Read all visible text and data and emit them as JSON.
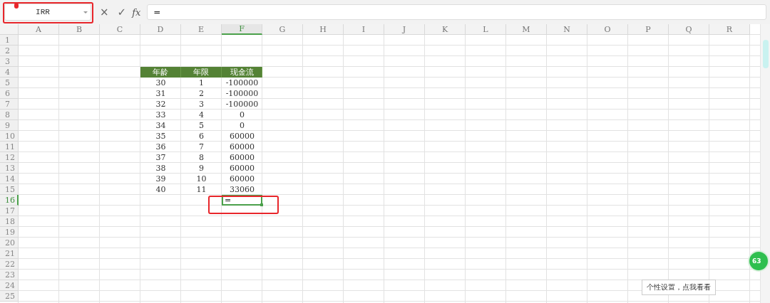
{
  "formula_bar": {
    "name_box": "IRR",
    "cancel_symbol": "×",
    "confirm_symbol": "✓",
    "function_label": "fx",
    "formula": "="
  },
  "columns": [
    {
      "label": "A",
      "selected": false
    },
    {
      "label": "B",
      "selected": false
    },
    {
      "label": "C",
      "selected": false
    },
    {
      "label": "D",
      "selected": false
    },
    {
      "label": "E",
      "selected": false
    },
    {
      "label": "F",
      "selected": true
    },
    {
      "label": "G",
      "selected": false
    },
    {
      "label": "H",
      "selected": false
    },
    {
      "label": "I",
      "selected": false
    },
    {
      "label": "J",
      "selected": false
    },
    {
      "label": "K",
      "selected": false
    },
    {
      "label": "L",
      "selected": false
    },
    {
      "label": "M",
      "selected": false
    },
    {
      "label": "N",
      "selected": false
    },
    {
      "label": "O",
      "selected": false
    },
    {
      "label": "P",
      "selected": false
    },
    {
      "label": "Q",
      "selected": false
    },
    {
      "label": "R",
      "selected": false
    }
  ],
  "rows": [
    {
      "label": "1",
      "selected": false
    },
    {
      "label": "2",
      "selected": false
    },
    {
      "label": "3",
      "selected": false
    },
    {
      "label": "4",
      "selected": false,
      "header": true,
      "cells": {
        "D": "年龄",
        "E": "年限",
        "F": "现金流"
      }
    },
    {
      "label": "5",
      "selected": false,
      "cells": {
        "D": "30",
        "E": "1",
        "F": "-100000"
      }
    },
    {
      "label": "6",
      "selected": false,
      "cells": {
        "D": "31",
        "E": "2",
        "F": "-100000"
      }
    },
    {
      "label": "7",
      "selected": false,
      "cells": {
        "D": "32",
        "E": "3",
        "F": "-100000"
      }
    },
    {
      "label": "8",
      "selected": false,
      "cells": {
        "D": "33",
        "E": "4",
        "F": "0"
      }
    },
    {
      "label": "9",
      "selected": false,
      "cells": {
        "D": "34",
        "E": "5",
        "F": "0"
      }
    },
    {
      "label": "10",
      "selected": false,
      "cells": {
        "D": "35",
        "E": "6",
        "F": "60000"
      }
    },
    {
      "label": "11",
      "selected": false,
      "cells": {
        "D": "36",
        "E": "7",
        "F": "60000"
      }
    },
    {
      "label": "12",
      "selected": false,
      "cells": {
        "D": "37",
        "E": "8",
        "F": "60000"
      }
    },
    {
      "label": "13",
      "selected": false,
      "cells": {
        "D": "38",
        "E": "9",
        "F": "60000"
      }
    },
    {
      "label": "14",
      "selected": false,
      "cells": {
        "D": "39",
        "E": "10",
        "F": "60000"
      }
    },
    {
      "label": "15",
      "selected": false,
      "cells": {
        "D": "40",
        "E": "11",
        "F": "33060"
      }
    },
    {
      "label": "16",
      "selected": true,
      "cells": {
        "F": "="
      }
    },
    {
      "label": "17",
      "selected": false
    },
    {
      "label": "18",
      "selected": false
    },
    {
      "label": "19",
      "selected": false
    },
    {
      "label": "20",
      "selected": false
    },
    {
      "label": "21",
      "selected": false
    },
    {
      "label": "22",
      "selected": false
    },
    {
      "label": "23",
      "selected": false
    },
    {
      "label": "24",
      "selected": false
    },
    {
      "label": "25",
      "selected": false
    }
  ],
  "floating_badge": "63",
  "tooltip": "个性设置，点我看看"
}
